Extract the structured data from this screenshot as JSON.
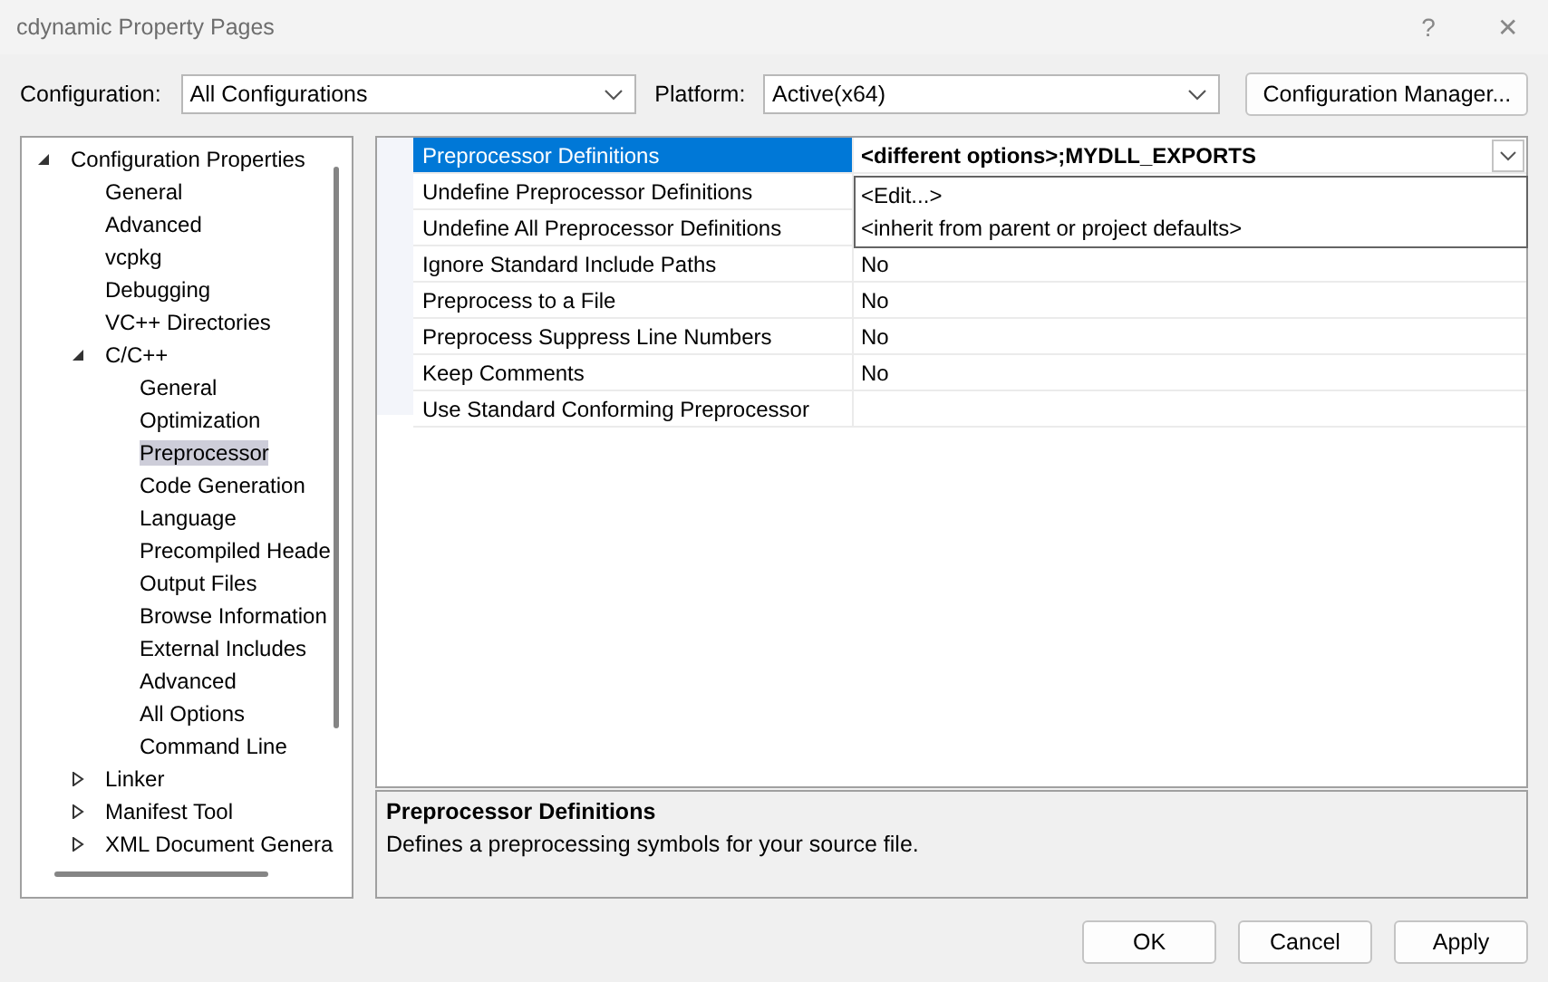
{
  "window": {
    "title": "cdynamic Property Pages",
    "help": "?",
    "close": "✕"
  },
  "configuration": {
    "label": "Configuration:",
    "value": "All Configurations"
  },
  "platform": {
    "label": "Platform:",
    "value": "Active(x64)"
  },
  "manager_button": "Configuration Manager...",
  "tree": [
    {
      "label": "Configuration Properties",
      "expanded": true,
      "selected": false,
      "children": [
        {
          "label": "General",
          "selected": false
        },
        {
          "label": "Advanced",
          "selected": false
        },
        {
          "label": "vcpkg",
          "selected": false
        },
        {
          "label": "Debugging",
          "selected": false
        },
        {
          "label": "VC++ Directories",
          "selected": false
        },
        {
          "label": "C/C++",
          "expanded": true,
          "selected": false,
          "children": [
            {
              "label": "General",
              "selected": false
            },
            {
              "label": "Optimization",
              "selected": false
            },
            {
              "label": "Preprocessor",
              "selected": true
            },
            {
              "label": "Code Generation",
              "selected": false
            },
            {
              "label": "Language",
              "selected": false
            },
            {
              "label": "Precompiled Heade",
              "selected": false
            },
            {
              "label": "Output Files",
              "selected": false
            },
            {
              "label": "Browse Information",
              "selected": false
            },
            {
              "label": "External Includes",
              "selected": false
            },
            {
              "label": "Advanced",
              "selected": false
            },
            {
              "label": "All Options",
              "selected": false
            },
            {
              "label": "Command Line",
              "selected": false
            }
          ]
        },
        {
          "label": "Linker",
          "expanded": false,
          "selected": false
        },
        {
          "label": "Manifest Tool",
          "expanded": false,
          "selected": false
        },
        {
          "label": "XML Document Genera",
          "expanded": false,
          "selected": false
        }
      ]
    }
  ],
  "properties": [
    {
      "name": "Preprocessor Definitions",
      "value": "<different options>;MYDLL_EXPORTS",
      "selected": true
    },
    {
      "name": "Undefine Preprocessor Definitions",
      "selected": false
    },
    {
      "name": "Undefine All Preprocessor Definitions",
      "selected": false
    },
    {
      "name": "Ignore Standard Include Paths",
      "value": "No",
      "selected": false
    },
    {
      "name": "Preprocess to a File",
      "value": "No",
      "selected": false
    },
    {
      "name": "Preprocess Suppress Line Numbers",
      "value": "No",
      "selected": false
    },
    {
      "name": "Keep Comments",
      "value": "No",
      "selected": false
    },
    {
      "name": "Use Standard Conforming Preprocessor",
      "selected": false
    }
  ],
  "dropdown_options": [
    "<Edit...>",
    "<inherit from parent or project defaults>"
  ],
  "description": {
    "title": "Preprocessor Definitions",
    "text": "Defines a preprocessing symbols for your source file."
  },
  "buttons": [
    "OK",
    "Cancel",
    "Apply"
  ]
}
